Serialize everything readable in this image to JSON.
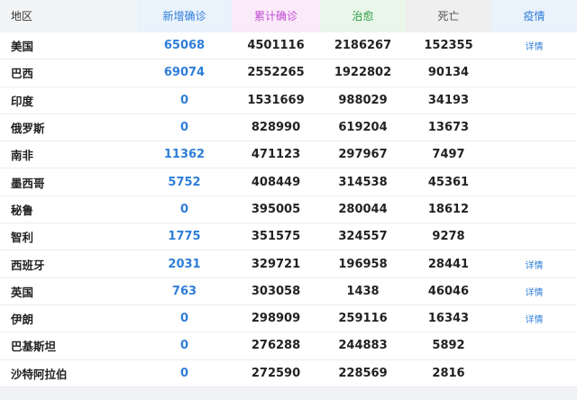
{
  "header": {
    "region": "地区",
    "new": "新增确诊",
    "total": "累计确诊",
    "cured": "治愈",
    "dead": "死亡",
    "detail": "疫情"
  },
  "rows": [
    {
      "region": "美国",
      "new": "65068",
      "total": "4501116",
      "cured": "2186267",
      "dead": "152355",
      "detail": "详情"
    },
    {
      "region": "巴西",
      "new": "69074",
      "total": "2552265",
      "cured": "1922802",
      "dead": "90134",
      "detail": ""
    },
    {
      "region": "印度",
      "new": "0",
      "total": "1531669",
      "cured": "988029",
      "dead": "34193",
      "detail": ""
    },
    {
      "region": "俄罗斯",
      "new": "0",
      "total": "828990",
      "cured": "619204",
      "dead": "13673",
      "detail": ""
    },
    {
      "region": "南非",
      "new": "11362",
      "total": "471123",
      "cured": "297967",
      "dead": "7497",
      "detail": ""
    },
    {
      "region": "墨西哥",
      "new": "5752",
      "total": "408449",
      "cured": "314538",
      "dead": "45361",
      "detail": ""
    },
    {
      "region": "秘鲁",
      "new": "0",
      "total": "395005",
      "cured": "280044",
      "dead": "18612",
      "detail": ""
    },
    {
      "region": "智利",
      "new": "1775",
      "total": "351575",
      "cured": "324557",
      "dead": "9278",
      "detail": ""
    },
    {
      "region": "西班牙",
      "new": "2031",
      "total": "329721",
      "cured": "196958",
      "dead": "28441",
      "detail": "详情"
    },
    {
      "region": "英国",
      "new": "763",
      "total": "303058",
      "cured": "1438",
      "dead": "46046",
      "detail": "详情"
    },
    {
      "region": "伊朗",
      "new": "0",
      "total": "298909",
      "cured": "259116",
      "dead": "16343",
      "detail": "详情"
    },
    {
      "region": "巴基斯坦",
      "new": "0",
      "total": "276288",
      "cured": "244883",
      "dead": "5892",
      "detail": ""
    },
    {
      "region": "沙特阿拉伯",
      "new": "0",
      "total": "272590",
      "cured": "228569",
      "dead": "2816",
      "detail": ""
    }
  ]
}
